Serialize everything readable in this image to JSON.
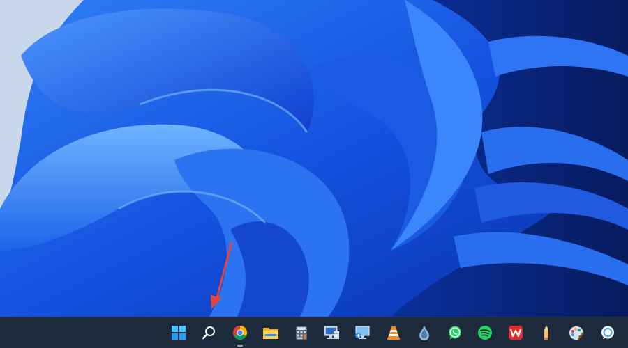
{
  "desktop": {
    "wallpaper": "windows-11-bloom-blue",
    "annotation": "red-arrow-pointing-to-taskbar"
  },
  "colors": {
    "taskbar_background": "#1c2a3c",
    "wallpaper_accent": "#1a55d8",
    "arrow": "#e5433c"
  },
  "taskbar": {
    "icons": [
      {
        "name": "start-icon",
        "running": false
      },
      {
        "name": "search-icon",
        "running": false
      },
      {
        "name": "chrome-icon",
        "running": true
      },
      {
        "name": "file-explorer-icon",
        "running": false
      },
      {
        "name": "calculator-icon",
        "running": false
      },
      {
        "name": "computer-management-icon",
        "running": false
      },
      {
        "name": "remote-desktop-icon",
        "running": false
      },
      {
        "name": "vlc-icon",
        "running": false
      },
      {
        "name": "water-drop-icon",
        "running": false
      },
      {
        "name": "whatsapp-icon",
        "running": false
      },
      {
        "name": "spotify-icon",
        "running": false
      },
      {
        "name": "wps-office-icon",
        "running": false
      },
      {
        "name": "pencil-icon",
        "running": false
      },
      {
        "name": "paint-icon",
        "running": false
      },
      {
        "name": "chat-bubble-icon",
        "running": false
      }
    ]
  }
}
